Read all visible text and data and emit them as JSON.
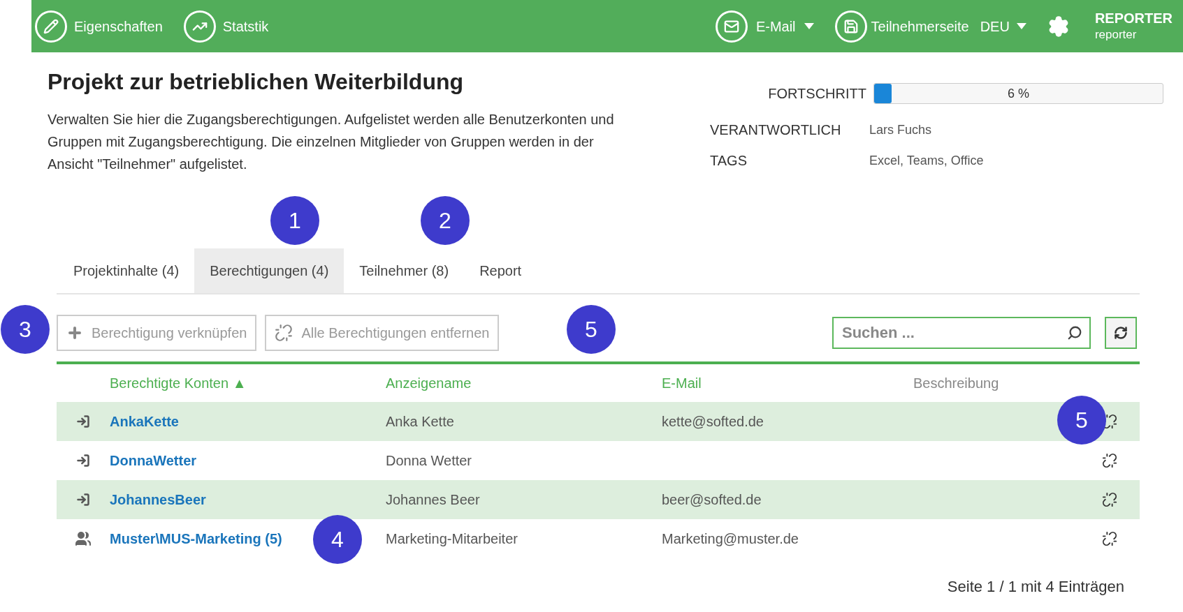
{
  "topbar": {
    "left": [
      {
        "kind": "edit",
        "label": "Eigenschaften"
      },
      {
        "kind": "chart",
        "label": "Statstik"
      }
    ],
    "mail": {
      "label": "E-Mail"
    },
    "participant_page": {
      "label": "Teilnehmerseite"
    },
    "language": {
      "label": "DEU"
    },
    "user": {
      "name": "REPORTER",
      "login": "reporter"
    }
  },
  "title": "Projekt zur betrieblichen Weiterbildung",
  "description": "Verwalten Sie hier die Zugangsberechtigungen. Aufgelistet werden alle Benutzerkonten und Gruppen mit Zugangsberechtigung. Die einzelnen Mitglieder von Gruppen werden in der Ansicht \"Teilnehmer\" aufgelistet.",
  "info": {
    "progress": {
      "label": "FORTSCHRITT",
      "level": 0.06,
      "reading": "6 %"
    },
    "owner": {
      "label": "VERANTWORTLICH",
      "value": "Lars Fuchs"
    },
    "tags": {
      "label": "TAGS",
      "value": "Excel, Teams, Office"
    }
  },
  "tabs": [
    {
      "label": "Projektinhalte (4)",
      "selected": false
    },
    {
      "label": "Berechtigungen (4)",
      "selected": true
    },
    {
      "label": "Teilnehmer (8)",
      "selected": false
    },
    {
      "label": "Report",
      "selected": false
    }
  ],
  "toolbar": {
    "buttons": [
      {
        "kind": "add",
        "label": "Berechtigung verknüpfen"
      },
      {
        "kind": "unlink",
        "label": "Alle Berechtigungen entfernen"
      }
    ],
    "search": {
      "placeholder": "Suchen ..."
    }
  },
  "table": {
    "columns": [
      {
        "label": "Berechtigte Konten",
        "sortable": true,
        "sort_indicator": "▲"
      },
      {
        "label": "Anzeigename",
        "sortable": true
      },
      {
        "label": "E-Mail",
        "sortable": true
      },
      {
        "label": "Beschreibung",
        "sortable": false
      }
    ],
    "rows": [
      {
        "kind": "user",
        "account": "AnkaKette",
        "display_name": "Anka Kette",
        "email": "kette@softed.de"
      },
      {
        "kind": "user",
        "account": "DonnaWetter",
        "display_name": "Donna Wetter"
      },
      {
        "kind": "user",
        "account": "JohannesBeer",
        "display_name": "Johannes Beer",
        "email": "beer@softed.de"
      },
      {
        "kind": "group",
        "account": "Muster\\MUS-Marketing (5)",
        "display_name": "Marketing-Mitarbeiter",
        "email": "Marketing@muster.de"
      }
    ]
  },
  "pagination": "Seite 1 / 1 mit 4 Einträgen",
  "callouts": [
    {
      "label": "1"
    },
    {
      "label": "2"
    },
    {
      "label": "3"
    },
    {
      "label": "5"
    },
    {
      "label": "5"
    },
    {
      "label": "4"
    }
  ]
}
